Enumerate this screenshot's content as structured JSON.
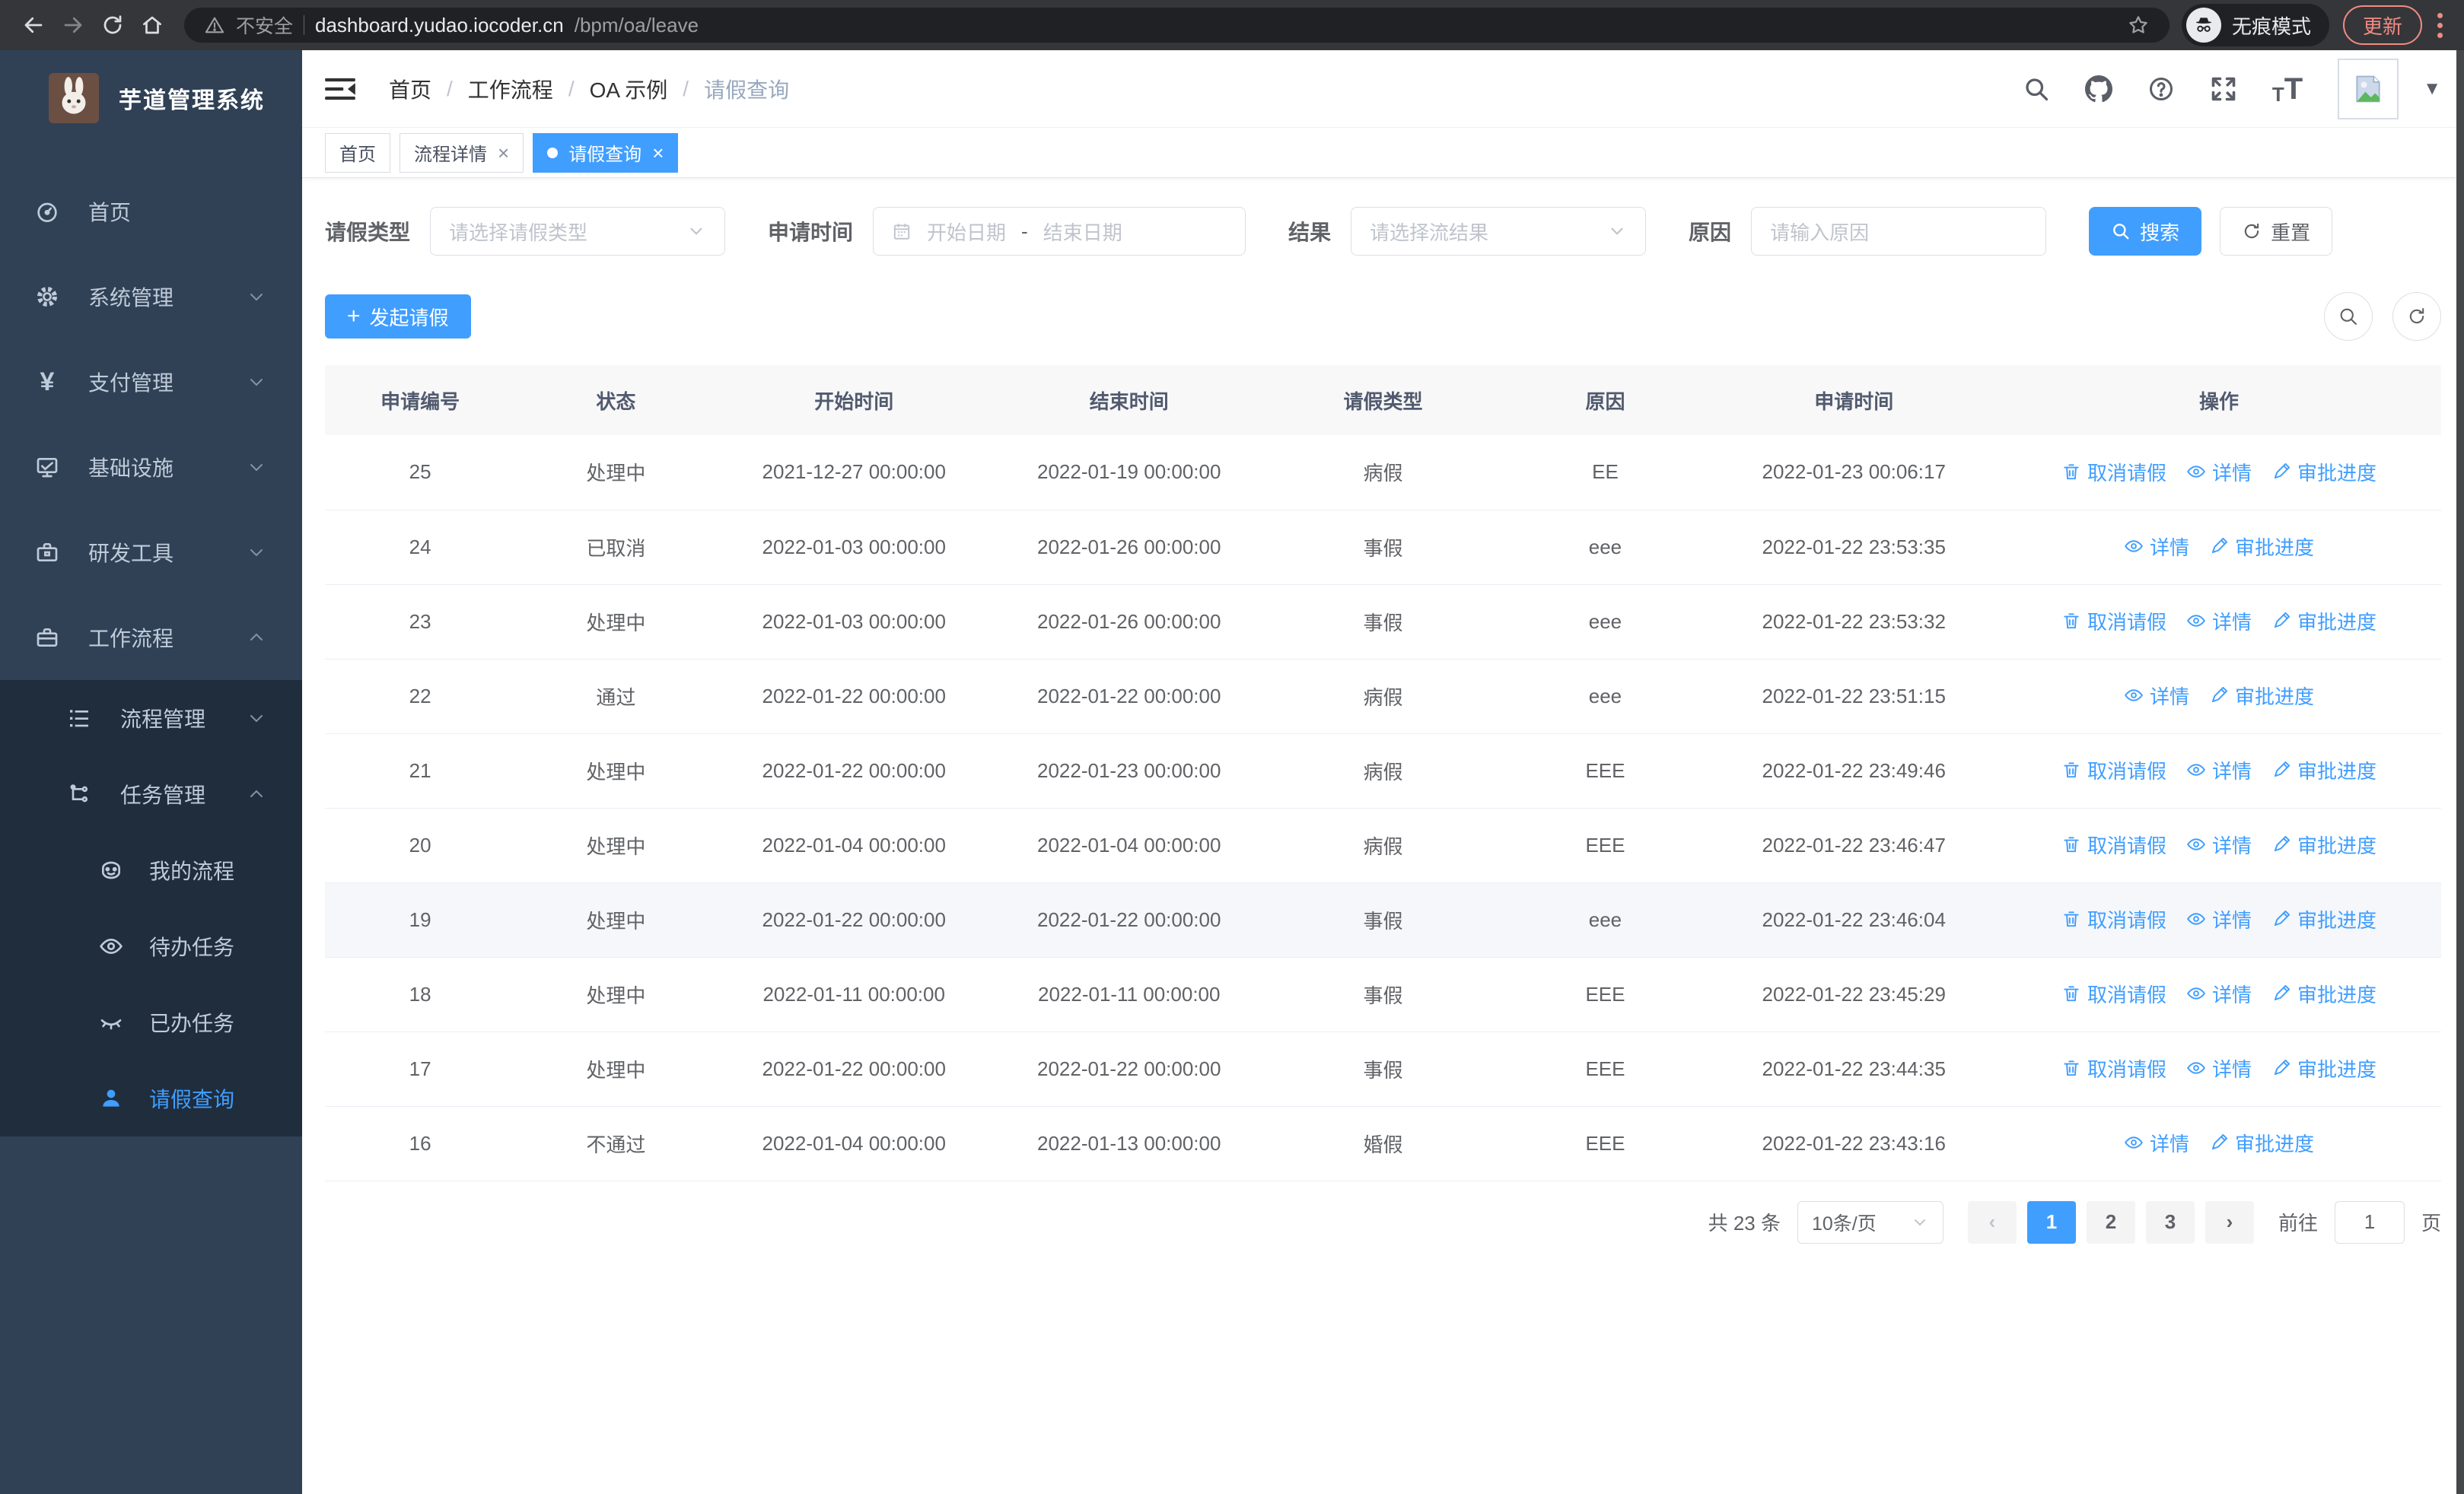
{
  "browser": {
    "security_label": "不安全",
    "url_host": "dashboard.yudao.iocoder.cn",
    "url_path": "/bpm/oa/leave",
    "incognito_label": "无痕模式",
    "update_label": "更新"
  },
  "icons": {
    "yen_glyph": "¥",
    "close_glyph": "×",
    "caret_down_glyph": "▼",
    "prev_glyph": "‹",
    "next_glyph": "›",
    "slash_glyph": "/",
    "dash_glyph": "-",
    "plus_glyph": "+",
    "text_size_glyph": "T"
  },
  "sidebar": {
    "title": "芋道管理系统",
    "items": [
      {
        "label": "首页"
      },
      {
        "label": "系统管理"
      },
      {
        "label": "支付管理"
      },
      {
        "label": "基础设施"
      },
      {
        "label": "研发工具"
      },
      {
        "label": "工作流程",
        "children": [
          {
            "label": "流程管理"
          },
          {
            "label": "任务管理",
            "children": [
              {
                "label": "我的流程"
              },
              {
                "label": "待办任务"
              },
              {
                "label": "已办任务"
              },
              {
                "label": "请假查询",
                "active": true
              }
            ]
          }
        ]
      }
    ]
  },
  "breadcrumb": {
    "items": [
      "首页",
      "工作流程",
      "OA 示例",
      "请假查询"
    ]
  },
  "tabs": [
    {
      "label": "首页"
    },
    {
      "label": "流程详情"
    },
    {
      "label": "请假查询"
    }
  ],
  "filters": {
    "leave_type_label": "请假类型",
    "leave_type_placeholder": "请选择请假类型",
    "apply_time_label": "申请时间",
    "date_start_placeholder": "开始日期",
    "date_separator": "-",
    "date_end_placeholder": "结束日期",
    "result_label": "结果",
    "result_placeholder": "请选择流结果",
    "reason_label": "原因",
    "reason_placeholder": "请输入原因",
    "search_label": "搜索",
    "reset_label": "重置"
  },
  "toolbar": {
    "create_label": "发起请假"
  },
  "actions": {
    "cancel": "取消请假",
    "detail": "详情",
    "progress": "审批进度"
  },
  "table": {
    "columns": [
      "申请编号",
      "状态",
      "开始时间",
      "结束时间",
      "请假类型",
      "原因",
      "申请时间",
      "操作"
    ],
    "rows": [
      {
        "id": "25",
        "status": "处理中",
        "start": "2021-12-27 00:00:00",
        "end": "2022-01-19 00:00:00",
        "type": "病假",
        "reason": "EE",
        "apply_time": "2022-01-23 00:06:17",
        "actions": [
          "cancel",
          "detail",
          "progress"
        ]
      },
      {
        "id": "24",
        "status": "已取消",
        "start": "2022-01-03 00:00:00",
        "end": "2022-01-26 00:00:00",
        "type": "事假",
        "reason": "eee",
        "apply_time": "2022-01-22 23:53:35",
        "actions": [
          "detail",
          "progress"
        ]
      },
      {
        "id": "23",
        "status": "处理中",
        "start": "2022-01-03 00:00:00",
        "end": "2022-01-26 00:00:00",
        "type": "事假",
        "reason": "eee",
        "apply_time": "2022-01-22 23:53:32",
        "actions": [
          "cancel",
          "detail",
          "progress"
        ]
      },
      {
        "id": "22",
        "status": "通过",
        "start": "2022-01-22 00:00:00",
        "end": "2022-01-22 00:00:00",
        "type": "病假",
        "reason": "eee",
        "apply_time": "2022-01-22 23:51:15",
        "actions": [
          "detail",
          "progress"
        ]
      },
      {
        "id": "21",
        "status": "处理中",
        "start": "2022-01-22 00:00:00",
        "end": "2022-01-23 00:00:00",
        "type": "病假",
        "reason": "EEE",
        "apply_time": "2022-01-22 23:49:46",
        "actions": [
          "cancel",
          "detail",
          "progress"
        ]
      },
      {
        "id": "20",
        "status": "处理中",
        "start": "2022-01-04 00:00:00",
        "end": "2022-01-04 00:00:00",
        "type": "病假",
        "reason": "EEE",
        "apply_time": "2022-01-22 23:46:47",
        "actions": [
          "cancel",
          "detail",
          "progress"
        ]
      },
      {
        "id": "19",
        "status": "处理中",
        "start": "2022-01-22 00:00:00",
        "end": "2022-01-22 00:00:00",
        "type": "事假",
        "reason": "eee",
        "apply_time": "2022-01-22 23:46:04",
        "actions": [
          "cancel",
          "detail",
          "progress"
        ],
        "highlighted": true
      },
      {
        "id": "18",
        "status": "处理中",
        "start": "2022-01-11 00:00:00",
        "end": "2022-01-11 00:00:00",
        "type": "事假",
        "reason": "EEE",
        "apply_time": "2022-01-22 23:45:29",
        "actions": [
          "cancel",
          "detail",
          "progress"
        ]
      },
      {
        "id": "17",
        "status": "处理中",
        "start": "2022-01-22 00:00:00",
        "end": "2022-01-22 00:00:00",
        "type": "事假",
        "reason": "EEE",
        "apply_time": "2022-01-22 23:44:35",
        "actions": [
          "cancel",
          "detail",
          "progress"
        ]
      },
      {
        "id": "16",
        "status": "不通过",
        "start": "2022-01-04 00:00:00",
        "end": "2022-01-13 00:00:00",
        "type": "婚假",
        "reason": "EEE",
        "apply_time": "2022-01-22 23:43:16",
        "actions": [
          "detail",
          "progress"
        ]
      }
    ]
  },
  "pagination": {
    "total_text": "共 23 条",
    "page_size_label": "10条/页",
    "pages": [
      "1",
      "2",
      "3"
    ],
    "active_page": "1",
    "goto_label": "前往",
    "goto_value": "1",
    "page_unit": "页"
  },
  "colors": {
    "primary": "#409eff",
    "sidebar_bg": "#304156",
    "submenu_bg": "#1f2d3d",
    "update_accent": "#f28b82"
  }
}
